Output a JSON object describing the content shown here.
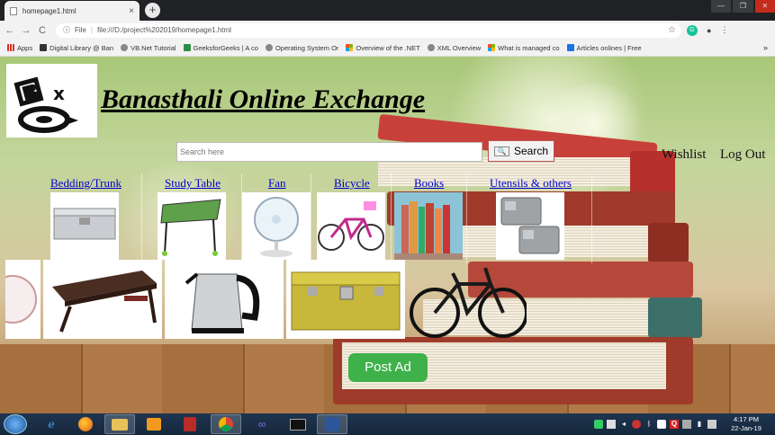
{
  "browser": {
    "tab_title": "homepage1.html",
    "tab_close": "×",
    "new_tab": "+",
    "window_controls": [
      "—",
      "❐",
      "✕"
    ],
    "back": "←",
    "forward": "→",
    "reload": "C",
    "info": "ⓘ",
    "scheme_label": "File",
    "url": "file:///D:/project%202019/homepage1.html",
    "star": "☆",
    "grammarly": "G",
    "profile": "●",
    "menu": "⋮"
  },
  "bookmarks": [
    {
      "label": "Apps",
      "icon": "apps-icon",
      "color": "#d93025"
    },
    {
      "label": "Digital Library @ Ban",
      "icon": "digital-library-icon",
      "color": "#333333"
    },
    {
      "label": "VB.Net Tutorial",
      "icon": "vbnet-icon",
      "color": "#777777"
    },
    {
      "label": "GeeksforGeeks | A co",
      "icon": "geeksforgeeks-icon",
      "color": "#2f8d46"
    },
    {
      "label": "Operating System Or",
      "icon": "os-icon",
      "color": "#777777"
    },
    {
      "label": "Overview of the .NET",
      "icon": "microsoft-icon",
      "color": "#f25022"
    },
    {
      "label": "XML Overview",
      "icon": "xml-icon",
      "color": "#777777"
    },
    {
      "label": "What is managed co",
      "icon": "microsoft-icon",
      "color": "#f25022"
    },
    {
      "label": "Articles onlines | Free",
      "icon": "articles-icon",
      "color": "#1a73e8"
    }
  ],
  "bookmarks_more": "»",
  "site": {
    "title": "Banasthali Online Exchange",
    "search_placeholder": "Search here",
    "search_button": "Search",
    "search_icon_glyph": "🔍",
    "wishlist": "Wishlist",
    "logout": "Log Out",
    "post_ad": "Post Ad",
    "categories": [
      "Bedding/Trunk",
      "Study Table",
      "Fan",
      "Bicycle",
      "Books",
      "Utensils & others"
    ]
  },
  "taskbar": {
    "clock_time": "4:17 PM",
    "clock_date": "22-Jan-19"
  }
}
